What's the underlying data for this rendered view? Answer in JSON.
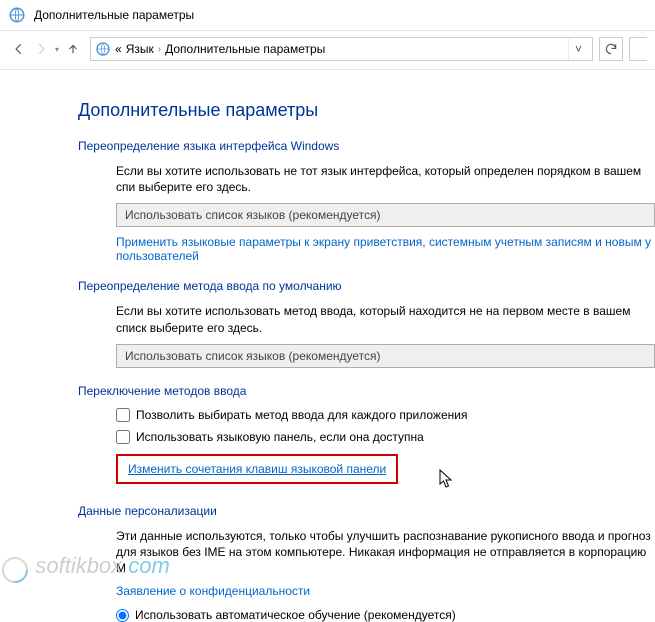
{
  "window": {
    "title": "Дополнительные параметры"
  },
  "breadcrumb": {
    "prefix": "«",
    "item1": "Язык",
    "item2": "Дополнительные параметры"
  },
  "page": {
    "heading": "Дополнительные параметры"
  },
  "section1": {
    "heading": "Переопределение языка интерфейса Windows",
    "desc": "Если вы хотите использовать не тот язык интерфейса, который определен порядком в вашем спи выберите его здесь.",
    "combo": "Использовать список языков (рекомендуется)",
    "link": "Применить языковые параметры к экрану приветствия, системным учетным записям и новым у пользователей"
  },
  "section2": {
    "heading": "Переопределение метода ввода по умолчанию",
    "desc": "Если вы хотите использовать метод ввода, который находится не на первом месте в вашем списк выберите его здесь.",
    "combo": "Использовать список языков (рекомендуется)"
  },
  "section3": {
    "heading": "Переключение методов ввода",
    "check1": "Позволить выбирать метод ввода для каждого приложения",
    "check2": "Использовать языковую панель, если она доступна",
    "link": "Изменить сочетания клавиш языковой панели"
  },
  "section4": {
    "heading": "Данные персонализации",
    "desc": "Эти данные используются, только чтобы улучшить распознавание рукописного ввода и прогноз для языков без IME на этом компьютере. Никакая информация не отправляется в корпорацию М",
    "link": "Заявление о конфиденциальности",
    "radio": "Использовать автоматическое обучение (рекомендуется)"
  },
  "watermark": {
    "t1": "softikbox",
    "t2": ".com"
  }
}
